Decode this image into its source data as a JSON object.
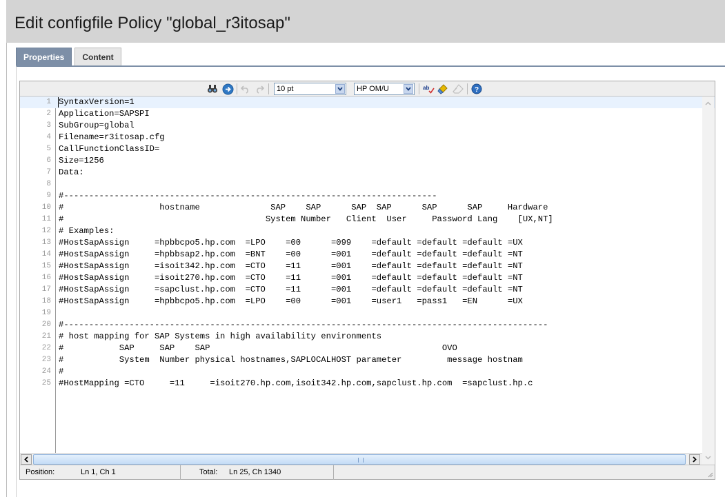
{
  "page": {
    "title": "Edit configfile Policy \"global_r3itosap\""
  },
  "tabs": [
    {
      "label": "Properties",
      "active": true
    },
    {
      "label": "Content",
      "active": false
    }
  ],
  "toolbar": {
    "icons": [
      "find-icon",
      "goto-icon",
      "undo-icon",
      "redo-icon",
      "spellcheck-icon",
      "clean-icon",
      "erase-icon",
      "help-icon"
    ],
    "font_size_value": "10 pt",
    "syntax_value": "HP OM/U"
  },
  "editor": {
    "lines": [
      {
        "n": "1",
        "text": "SyntaxVersion=1"
      },
      {
        "n": "2",
        "text": "Application=SAPSPI"
      },
      {
        "n": "3",
        "text": "SubGroup=global"
      },
      {
        "n": "4",
        "text": "Filename=r3itosap.cfg"
      },
      {
        "n": "5",
        "text": "CallFunctionClassID="
      },
      {
        "n": "6",
        "text": "Size=1256"
      },
      {
        "n": "7",
        "text": "Data:"
      },
      {
        "n": "8",
        "text": ""
      },
      {
        "n": "9",
        "text": "#--------------------------------------------------------------------------"
      },
      {
        "n": "10",
        "text": "#                   hostname              SAP    SAP      SAP  SAP      SAP      SAP     Hardware"
      },
      {
        "n": "11",
        "text": "#                                        System Number   Client  User     Password Lang    [UX,NT]"
      },
      {
        "n": "12",
        "text": "# Examples:"
      },
      {
        "n": "13",
        "text": "#HostSapAssign     =hpbbcpo5.hp.com  =LPO    =00      =099    =default =default =default =UX"
      },
      {
        "n": "14",
        "text": "#HostSapAssign     =hpbbsap2.hp.com  =BNT    =00      =001    =default =default =default =NT"
      },
      {
        "n": "15",
        "text": "#HostSapAssign     =isoit342.hp.com  =CTO    =11      =001    =default =default =default =NT"
      },
      {
        "n": "16",
        "text": "#HostSapAssign     =isoit270.hp.com  =CTO    =11      =001    =default =default =default =NT"
      },
      {
        "n": "17",
        "text": "#HostSapAssign     =sapclust.hp.com  =CTO    =11      =001    =default =default =default =NT"
      },
      {
        "n": "18",
        "text": "#HostSapAssign     =hpbbcpo5.hp.com  =LPO    =00      =001    =user1   =pass1   =EN      =UX"
      },
      {
        "n": "19",
        "text": ""
      },
      {
        "n": "20",
        "text": "#------------------------------------------------------------------------------------------------"
      },
      {
        "n": "21",
        "text": "# host mapping for SAP Systems in high availability environments"
      },
      {
        "n": "22",
        "text": "#           SAP     SAP    SAP                                              OVO"
      },
      {
        "n": "23",
        "text": "#           System  Number physical hostnames,SAPLOCALHOST parameter         message hostnam"
      },
      {
        "n": "24",
        "text": "#"
      },
      {
        "n": "25",
        "text": "#HostMapping =CTO     =11     =isoit270.hp.com,isoit342.hp.com,sapclust.hp.com  =sapclust.hp.c"
      }
    ]
  },
  "statusbar": {
    "position_label": "Position:",
    "position_value": "Ln 1, Ch 1",
    "total_label": "Total:",
    "total_value": "Ln 25, Ch 1340"
  }
}
